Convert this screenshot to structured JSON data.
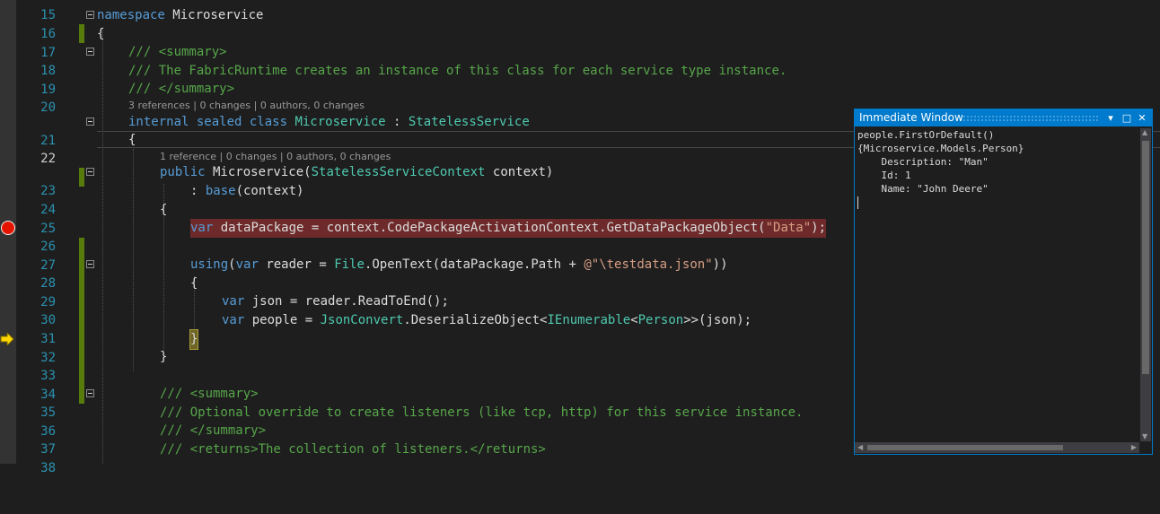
{
  "editor": {
    "lines": [
      {
        "n": "15"
      },
      {
        "n": "16"
      },
      {
        "n": "17"
      },
      {
        "n": "18"
      },
      {
        "n": "19"
      },
      {
        "n": "20"
      },
      {
        "n": "21"
      },
      {
        "n": "22"
      },
      {
        "n": "23"
      },
      {
        "n": "24"
      },
      {
        "n": "25"
      },
      {
        "n": "26"
      },
      {
        "n": "27"
      },
      {
        "n": "28"
      },
      {
        "n": "29"
      },
      {
        "n": "30"
      },
      {
        "n": "31"
      },
      {
        "n": "32"
      },
      {
        "n": "33"
      },
      {
        "n": "34"
      },
      {
        "n": "35"
      },
      {
        "n": "36"
      },
      {
        "n": "37"
      },
      {
        "n": "38"
      }
    ],
    "code": {
      "l16_kw": "namespace",
      "l16_name": " Microservice",
      "l17": "{",
      "l18": "/// <summary>",
      "l19": "/// The FabricRuntime creates an instance of this class for each service type instance.",
      "l20": "/// </summary>",
      "lens1": "3 references | 0 changes | 0 authors, 0 changes",
      "l21_kw": "internal sealed class",
      "l21_name": "Microservice",
      "l21_colon": " : ",
      "l21_base": "StatelessService",
      "l22": "{",
      "lens2": "1 reference | 0 changes | 0 authors, 0 changes",
      "l23_kw": "public",
      "l23_rest1": " Microservice(",
      "l23_type": "StatelessServiceContext",
      "l23_rest2": " context)",
      "l24_pre": ": ",
      "l24_kw": "base",
      "l24_rest": "(context)",
      "l25": "{",
      "l26_kw": "var",
      "l26_rest1": " dataPackage = context.CodePackageActivationContext.GetDataPackageObject(",
      "l26_str": "\"Data\"",
      "l26_rest2": ");",
      "l28_kw": "using",
      "l28_rest1": "(",
      "l28_kw2": "var",
      "l28_rest2": " reader = ",
      "l28_type": "File",
      "l28_rest3": ".OpenText(dataPackage.Path + ",
      "l28_str": "@\"\\testdata.json\"",
      "l28_rest4": "))",
      "l29": "{",
      "l30_kw": "var",
      "l30_rest": " json = reader.ReadToEnd();",
      "l31_kw": "var",
      "l31_rest1": " people = ",
      "l31_type1": "JsonConvert",
      "l31_rest2": ".DeserializeObject<",
      "l31_type2": "IEnumerable",
      "l31_rest3": "<",
      "l31_type3": "Person",
      "l31_rest4": ">>(json);",
      "l32": "}",
      "l33": "}",
      "l35": "/// <summary>",
      "l36": "/// Optional override to create listeners (like tcp, http) for this service instance.",
      "l37": "/// </summary>",
      "l38": "/// <returns>The collection of listeners.</returns>"
    },
    "colors": {
      "keyword": "#569cd6",
      "type": "#4ec9b0",
      "comment": "#57a64a",
      "string": "#d69d85",
      "breakpoint": "#e51400"
    }
  },
  "immediate_window": {
    "title": "Immediate Window",
    "buttons": {
      "dropdown": "▾",
      "maximize": "□",
      "close": "✕"
    },
    "lines": [
      "people.FirstOrDefault()",
      "{Microservice.Models.Person}",
      "    Description: \"Man\"",
      "    Id: 1",
      "    Name: \"John Deere\""
    ]
  }
}
